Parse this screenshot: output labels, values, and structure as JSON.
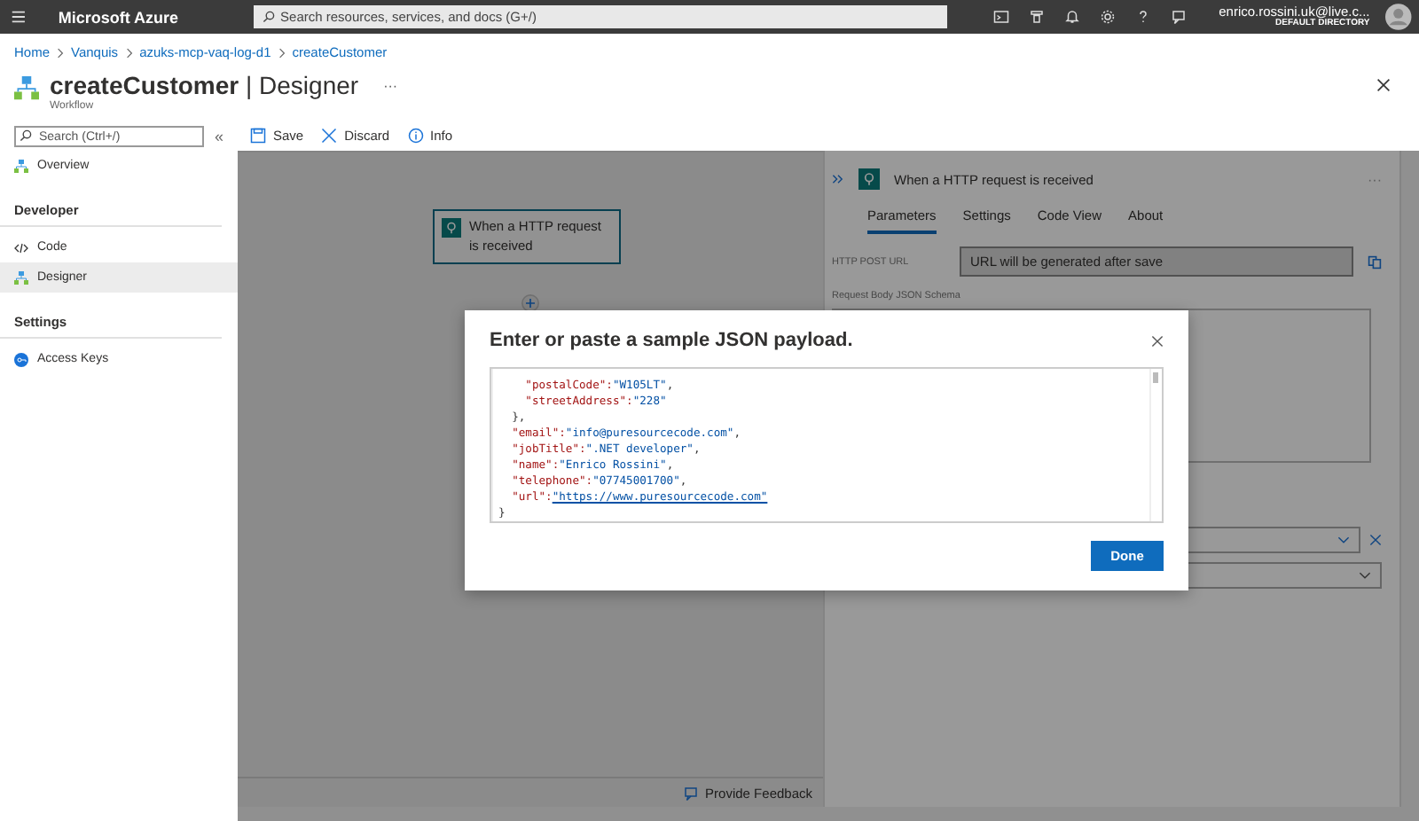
{
  "topbar": {
    "brand": "Microsoft Azure",
    "search": {
      "placeholder": "Search resources, services, and docs (G+/)"
    },
    "account": {
      "name": "enrico.rossini.uk@live.c...",
      "directory": "DEFAULT DIRECTORY"
    }
  },
  "breadcrumb": [
    "Home",
    "Vanquis",
    "azuks-mcp-vaq-log-d1",
    "createCustomer"
  ],
  "header": {
    "name": "createCustomer",
    "separator": "|",
    "section": "Designer",
    "subtitle": "Workflow",
    "more": "···"
  },
  "sidebar": {
    "search": {
      "placeholder": "Search (Ctrl+/)"
    },
    "collapse": "«",
    "groups": [
      {
        "items": [
          {
            "label": "Overview",
            "kind": "workflow",
            "selected": false
          }
        ]
      },
      {
        "heading": "Developer",
        "items": [
          {
            "label": "Code",
            "kind": "code",
            "selected": false
          },
          {
            "label": "Designer",
            "kind": "workflow",
            "selected": true
          }
        ]
      },
      {
        "heading": "Settings",
        "items": [
          {
            "label": "Access Keys",
            "kind": "key",
            "selected": false
          }
        ]
      }
    ]
  },
  "toolbar": [
    {
      "label": "Save",
      "kind": "save"
    },
    {
      "label": "Discard",
      "kind": "discard"
    },
    {
      "label": "Info",
      "kind": "info"
    }
  ],
  "canvas": {
    "trigger": "When a HTTP request is received",
    "feedback": "Provide Feedback"
  },
  "panel": {
    "title": "When a HTTP request is received",
    "more": "···",
    "tabs": [
      {
        "label": "Parameters",
        "selected": true
      },
      {
        "label": "Settings",
        "selected": false
      },
      {
        "label": "Code View",
        "selected": false
      },
      {
        "label": "About",
        "selected": false
      }
    ],
    "url_label": "HTTP POST URL",
    "url_value": "URL will be generated after save",
    "schema_label": "Request Body JSON Schema"
  },
  "dialog": {
    "title": "Enter or paste a sample JSON payload.",
    "lines": [
      {
        "kind": "pair",
        "key": "    \"postalCode\"",
        "sep": ":",
        "value": "\"W105LT\"",
        "trail": ","
      },
      {
        "kind": "pair",
        "key": "    \"streetAddress\"",
        "sep": ":",
        "value": "\"228\""
      },
      {
        "kind": "punct",
        "text": "  },"
      },
      {
        "kind": "pair",
        "key": "  \"email\"",
        "sep": ":",
        "value": "\"info@puresourcecode.com\"",
        "trail": ","
      },
      {
        "kind": "pair",
        "key": "  \"jobTitle\"",
        "sep": ":",
        "value": "\".NET developer\"",
        "trail": ","
      },
      {
        "kind": "pair",
        "key": "  \"name\"",
        "sep": ":",
        "value": "\"Enrico Rossini\"",
        "trail": ","
      },
      {
        "kind": "pair",
        "key": "  \"telephone\"",
        "sep": ":",
        "value": "\"07745001700\"",
        "trail": ","
      },
      {
        "kind": "link",
        "key": "  \"url\"",
        "sep": ":",
        "value": "\"https://www.puresourcecode.com\""
      },
      {
        "kind": "punct",
        "text": "}"
      }
    ],
    "button": "Done"
  }
}
